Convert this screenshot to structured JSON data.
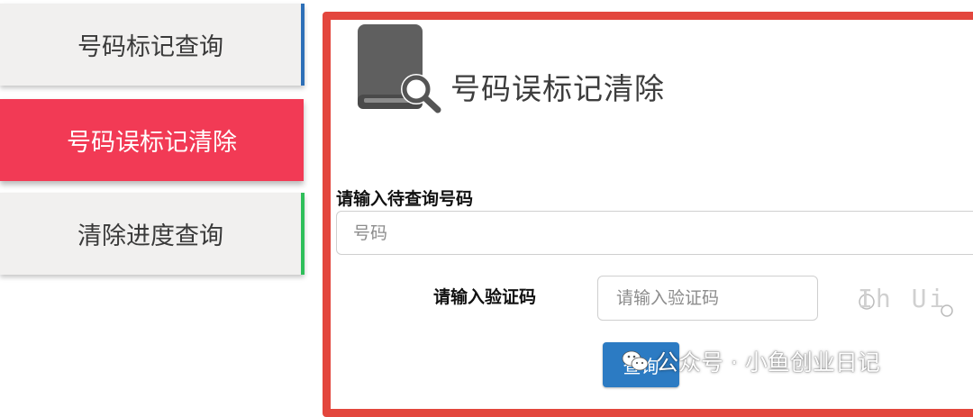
{
  "sidebar": {
    "items": [
      {
        "label": "号码标记查询"
      },
      {
        "label": "号码误标记清除"
      },
      {
        "label": "清除进度查询"
      }
    ]
  },
  "panel": {
    "title": "号码误标记清除",
    "phone_label": "请输入待查询号码",
    "phone_placeholder": "号码",
    "captcha_label": "请输入验证码",
    "captcha_placeholder": "请输入验证码",
    "captcha_text": "Ih Ui",
    "query_button": "查询"
  },
  "watermark": {
    "text": "公众号 · 小鱼创业日记"
  },
  "colors": {
    "active_item": "#f23a55",
    "highlight_border": "#e3463d",
    "button": "#2c7bc3",
    "item1_accent": "#2d6fb7",
    "item3_accent": "#2fbf5a"
  },
  "icons": [
    "book-search-icon",
    "wechat-icon"
  ]
}
